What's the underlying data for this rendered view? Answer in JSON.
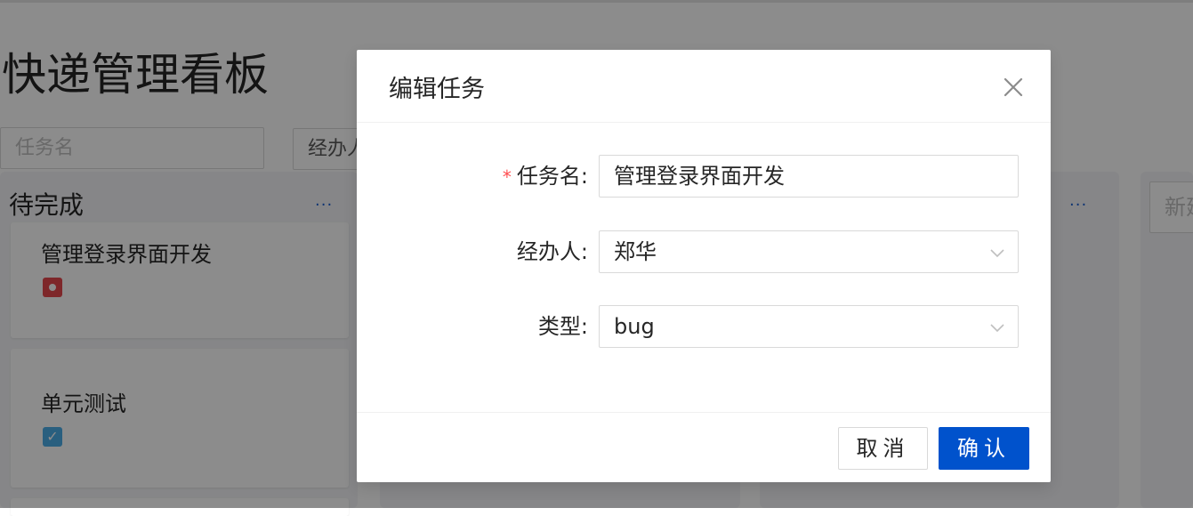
{
  "board": {
    "title": "快递管理看板",
    "search_placeholder": "任务名",
    "assignee_select_value": "经办人",
    "new_column_placeholder": "新建",
    "columns": [
      {
        "title": "待完成",
        "more": "...",
        "cards": [
          {
            "title": "管理登录界面开发",
            "type_icon": "bug-icon"
          },
          {
            "title": "单元测试",
            "type_icon": "task-icon"
          }
        ]
      },
      {
        "title": "",
        "more": ""
      },
      {
        "title": "",
        "more": "..."
      }
    ]
  },
  "modal": {
    "title": "编辑任务",
    "fields": {
      "name": {
        "label": "任务名:",
        "required_mark": "*",
        "value": "管理登录界面开发"
      },
      "assignee": {
        "label": "经办人:",
        "value": "郑华"
      },
      "type": {
        "label": "类型:",
        "value": "bug"
      }
    },
    "cancel_label": "取消",
    "ok_label": "确认"
  },
  "colors": {
    "primary": "#0052cc",
    "required": "#ff4d4f",
    "bug": "#e5484d",
    "task": "#4bade8",
    "mask": "rgba(0,0,0,0.45)"
  }
}
